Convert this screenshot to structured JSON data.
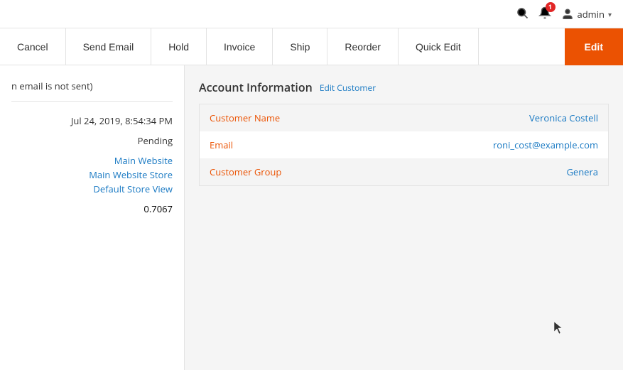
{
  "topbar": {
    "notification_count": "1",
    "admin_label": "admin",
    "chevron": "▾"
  },
  "toolbar": {
    "cancel_label": "Cancel",
    "send_email_label": "Send Email",
    "hold_label": "Hold",
    "invoice_label": "Invoice",
    "ship_label": "Ship",
    "reorder_label": "Reorder",
    "quick_edit_label": "Quick Edit",
    "edit_label": "Edit"
  },
  "left_panel": {
    "email_notice": "n email is not sent)",
    "date_value": "Jul 24, 2019, 8:54:34 PM",
    "status_value": "Pending",
    "store_main": "Main Website",
    "store_sub": "Main Website Store",
    "store_view": "Default Store View",
    "number_value": "0.7067"
  },
  "account_info": {
    "section_title": "Account Information",
    "edit_customer_label": "Edit Customer",
    "customer_name_label": "Customer Name",
    "customer_name_value": "Veronica Costell",
    "email_label": "Email",
    "email_value": "roni_cost@example.com",
    "customer_group_label": "Customer Group",
    "customer_group_value": "Genera"
  }
}
